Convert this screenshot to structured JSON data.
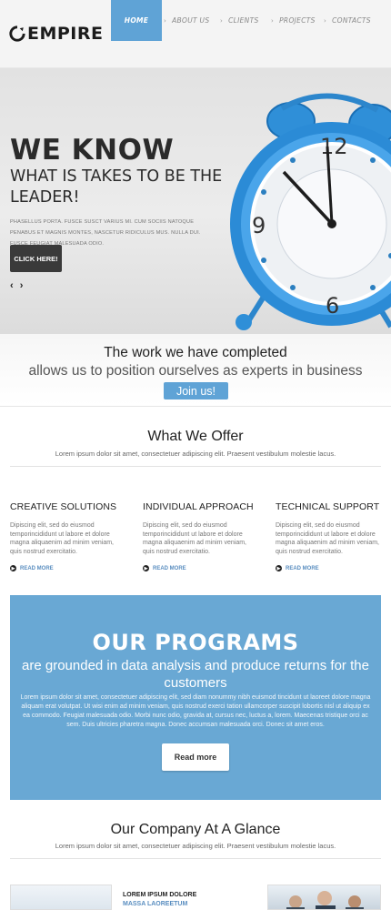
{
  "brand": {
    "name": "EMPIRE",
    "accent": "#5fa3d6"
  },
  "nav": [
    {
      "label": "HOME",
      "active": true
    },
    {
      "label": "ABOUT US",
      "active": false
    },
    {
      "label": "CLIENTS",
      "active": false
    },
    {
      "label": "PROJECTS",
      "active": false
    },
    {
      "label": "CONTACTS",
      "active": false
    }
  ],
  "hero": {
    "title": "WE KNOW",
    "subtitle": "WHAT IS TAKES TO BE THE LEADER!",
    "text": "PHASELLUS PORTA. FUSCE SUSCT VARIUS MI. CUM SOCIIS NATOQUE PENABUS ET MAGNIS MONTES, NASCETUR RIDICULUS MUS. NULLA DUI. FUSCE FEUGIAT MALESUADA ODIO.",
    "button": "CLICK HERE!",
    "slider_arrows": "‹ ›",
    "image_icon": "alarm-clock"
  },
  "work": {
    "line1": "The work we have completed",
    "line2": "allows us to position ourselves as experts in business",
    "button": "Join us!"
  },
  "offer": {
    "title": "What We Offer",
    "subtitle": "Lorem ipsum dolor sit amet, consectetuer adipiscing elit. Praesent vestibulum molestie lacus.",
    "columns": [
      {
        "title": "CREATIVE SOLUTIONS",
        "text": "Dipiscing elit, sed do eiusmod temporincididunt ut labore et dolore magna aliquaenim ad minim veniam, quis nostrud exercitatio.",
        "more": "READ MORE"
      },
      {
        "title": "INDIVIDUAL APPROACH",
        "text": "Dipiscing elit, sed do eiusmod temporincididunt ut labore et dolore magna aliquaenim ad minim veniam, quis nostrud exercitatio.",
        "more": "READ MORE"
      },
      {
        "title": "TECHNICAL SUPPORT",
        "text": "Dipiscing elit, sed do eiusmod temporincididunt ut labore et dolore magna aliquaenim ad minim veniam, quis nostrud exercitatio.",
        "more": "READ MORE"
      }
    ]
  },
  "programs": {
    "title": "OUR PROGRAMS",
    "subtitle": "are grounded in data analysis and produce returns for the customers",
    "text": "Lorem ipsum dolor sit amet, consectetuer adipiscing elit, sed diam nonummy nibh euismod tincidunt ut laoreet dolore magna aliquam erat volutpat. Ut wisi enim ad minim veniam, quis nostrud exerci tation ullamcorper suscipit lobortis nisl ut aliquip ex ea commodo. Feugiat malesuada odio. Morbi nunc odio, gravida at, cursus nec, luctus a, lorem. Maecenas tristique orci ac sem. Duis ultricies pharetra magna. Donec accumsan malesuada orci. Donec sit amet eros.",
    "button": "Read more",
    "background": "#69a8d4"
  },
  "glance": {
    "title": "Our Company At A Glance",
    "subtitle": "Lorem ipsum dolor sit amet, consectetuer adipiscing elit. Praesent vestibulum molestie lacus.",
    "item_title": "LOREM IPSUM DOLORE",
    "item_subtitle": "MASSA LAOREETUM"
  }
}
